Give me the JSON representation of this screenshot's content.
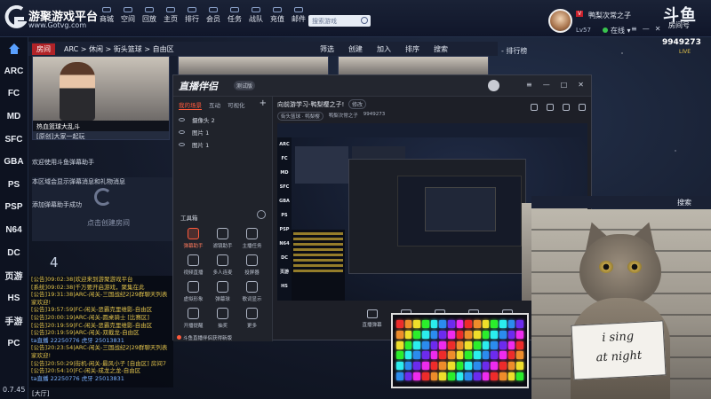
{
  "app": {
    "brand": "游聚游戏平台",
    "url": "www.Gotvg.com",
    "version": "0.7.45"
  },
  "topnav": [
    {
      "label": "商城"
    },
    {
      "label": "空间"
    },
    {
      "label": "回放"
    },
    {
      "label": "主页"
    },
    {
      "label": "排行"
    },
    {
      "label": "会员"
    },
    {
      "label": "任务"
    },
    {
      "label": "战队"
    },
    {
      "label": "充值"
    },
    {
      "label": "邮件"
    }
  ],
  "search": {
    "placeholder": "搜索游戏"
  },
  "user": {
    "vip": "V",
    "name": "鸭梨次常之子",
    "level": "Lv57",
    "status": "在线"
  },
  "room_badge": {
    "logo": "斗鱼",
    "label": "房间号",
    "number": "9949273",
    "tag": "LIVE"
  },
  "rail": [
    "ARC",
    "FC",
    "MD",
    "SFC",
    "GBA",
    "PS",
    "PSP",
    "N64",
    "DC",
    "页游",
    "HS",
    "手游",
    "PC"
  ],
  "subbar": {
    "current": "房间",
    "breadcrumb": "ARC > 休闲 > 街头篮球 > 自由区",
    "actions": [
      "筛选",
      "创建",
      "加入",
      "排序",
      "搜索"
    ]
  },
  "rank_title": "- 排行榜",
  "rooms": [
    {
      "name": "热血篮球大乱斗",
      "desc": "[原创]大家一起玩"
    }
  ],
  "create_room": "点击创建房间",
  "notices": [
    "欢迎使用斗鱼弹幕助手",
    "本区域会显示弹幕消息和礼物消息",
    "添加弹幕助手成功"
  ],
  "big_number": "4",
  "chat": [
    "[公告]09:02:38|欢迎来到游聚游戏平台",
    "[系统]09:02:38|千万要开启游戏，聚集在此",
    "[公告]19:31:38|ARC-闲关-三国战纪2|29群聊天列表",
    "家欢迎!",
    "[公告]19:57:59|FC-闲关-恶霸克里维影-自由区",
    "[公告]20:00:19|ARC-闲关-圆桌骑士 [比赛区]",
    "[公告]20:19:59|FC-闲关-恶霸克里维影-自由区",
    "[公告]20:19:59|ARC-闲关-双截龙-自由区",
    "ta直播 22250776 虎牙 25013831",
    "[公告]20:23:54|ARC-闲关-三国战纪2|29群聊天列表",
    "家欢迎!",
    "[公告]20:50:29|街机-闲关-最风小子 [自由区] 房间7",
    "[公告]20:54:10|FC-闲关-成龙之龙-自由区",
    "ta直播 22250776 虎牙 25013831"
  ],
  "hall": "[大厅]",
  "streamer": {
    "logo": "直播伴侣",
    "version": "测试版",
    "tabs": [
      "我的场景",
      "互动",
      "可视化"
    ],
    "sources": [
      "摄像头 2",
      "图片 1",
      "图片 1"
    ],
    "tools_title": "工具箱",
    "tools": [
      "弹幕助手",
      "滤镜助手",
      "主播任务",
      "视频直播",
      "多人连麦",
      "投屏器",
      "虚拟形象",
      "弹幕球",
      "歌词显示",
      "开播提醒",
      "抽奖",
      "更多"
    ],
    "bottom_notice": "斗鱼直播伴侣获得新版",
    "room_title": "向前游学习-鸭梨樱之子!",
    "edit": "修改",
    "meta": [
      "街头篮球 · 鸭梨樱",
      "鸭梨次常之子",
      "9949273"
    ],
    "bottom_buttons": [
      "直播弹幕",
      "摄像头",
      "直播设置",
      "屏幕直播",
      "游戏直播"
    ]
  },
  "camera": {
    "header_action": "搜索",
    "sign_line1": "i sing",
    "sign_line2": "at night"
  },
  "colors": {
    "accent_red": "#b12328",
    "chat_yellow": "#e0c24b",
    "obs_accent": "#ff5a3c",
    "online_green": "#39c44e"
  }
}
